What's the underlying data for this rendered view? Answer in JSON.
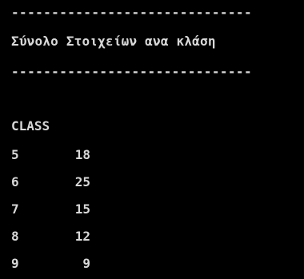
{
  "console": {
    "separator_top": "------------------------------",
    "heading": "Σύνολο Στοιχείων ανα κλάση",
    "separator_bottom": "------------------------------",
    "column_header": "CLASS",
    "rows": [
      {
        "class": "5",
        "count": "18"
      },
      {
        "class": "6",
        "count": "25"
      },
      {
        "class": "7",
        "count": "15"
      },
      {
        "class": "8",
        "count": "12"
      },
      {
        "class": "9",
        "count": "9"
      }
    ]
  },
  "colors": {
    "background": "#000000",
    "text": "#d8d8d8"
  }
}
